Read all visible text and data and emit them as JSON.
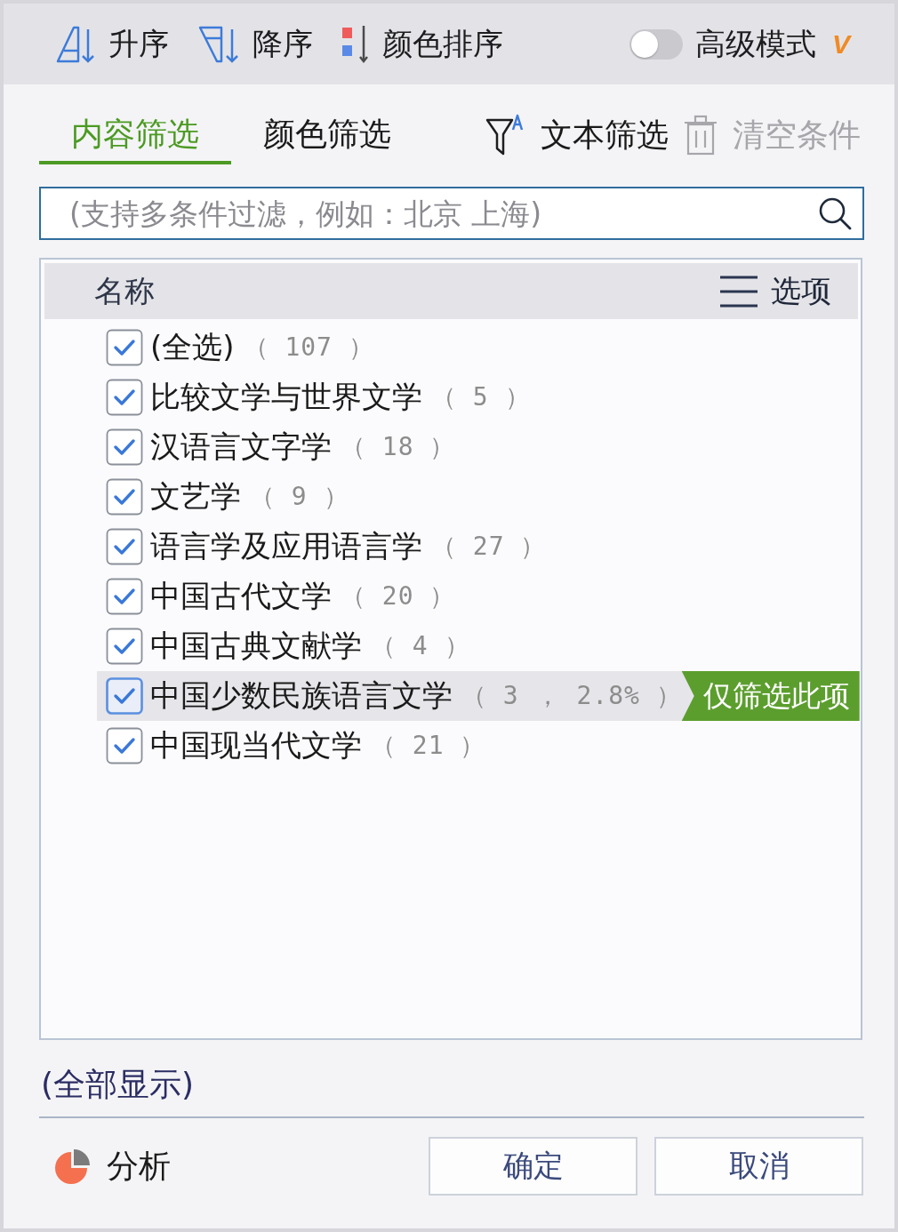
{
  "toolbar": {
    "sort_buttons": [
      {
        "kind": "ascending",
        "label": "升序"
      },
      {
        "kind": "descending",
        "label": "降序"
      },
      {
        "kind": "color",
        "label": "颜色排序"
      }
    ],
    "advanced_mode": {
      "label": "高级模式",
      "on": false,
      "badge": "V"
    }
  },
  "tabs": [
    {
      "label": "内容筛选",
      "selected": true
    },
    {
      "label": "颜色筛选",
      "selected": false
    }
  ],
  "actions": [
    {
      "kind": "text_filter",
      "label": "文本筛选",
      "disabled": false
    },
    {
      "kind": "clear",
      "label": "清空条件",
      "disabled": true
    }
  ],
  "search": {
    "placeholder": "(支持多条件过滤，例如：北京 上海)"
  },
  "list": {
    "header": "名称",
    "options_label": "选项",
    "items": [
      {
        "label": "(全选)",
        "count": "（ 107 ）",
        "checked": true,
        "selected": false
      },
      {
        "label": "比较文学与世界文学",
        "count": "（ 5 ）",
        "checked": true,
        "selected": false
      },
      {
        "label": "汉语言文字学",
        "count": "（ 18 ）",
        "checked": true,
        "selected": false
      },
      {
        "label": "文艺学",
        "count": "（ 9 ）",
        "checked": true,
        "selected": false
      },
      {
        "label": "语言学及应用语言学",
        "count": "（ 27 ）",
        "checked": true,
        "selected": false
      },
      {
        "label": "中国古代文学",
        "count": "（ 20 ）",
        "checked": true,
        "selected": false
      },
      {
        "label": "中国古典文献学",
        "count": "（ 4 ）",
        "checked": true,
        "selected": false
      },
      {
        "label": "中国少数民族语言文学",
        "count": "（ 3 ， 2.8% ）",
        "checked": true,
        "selected": true,
        "filter_only_button": "仅筛选此项"
      },
      {
        "label": "中国现当代文学",
        "count": "（ 21 ）",
        "checked": true,
        "selected": false
      }
    ]
  },
  "show_all": "(全部显示)",
  "analysis": {
    "label": "分析"
  },
  "buttons": [
    {
      "label": "确定"
    },
    {
      "label": "取消"
    }
  ]
}
